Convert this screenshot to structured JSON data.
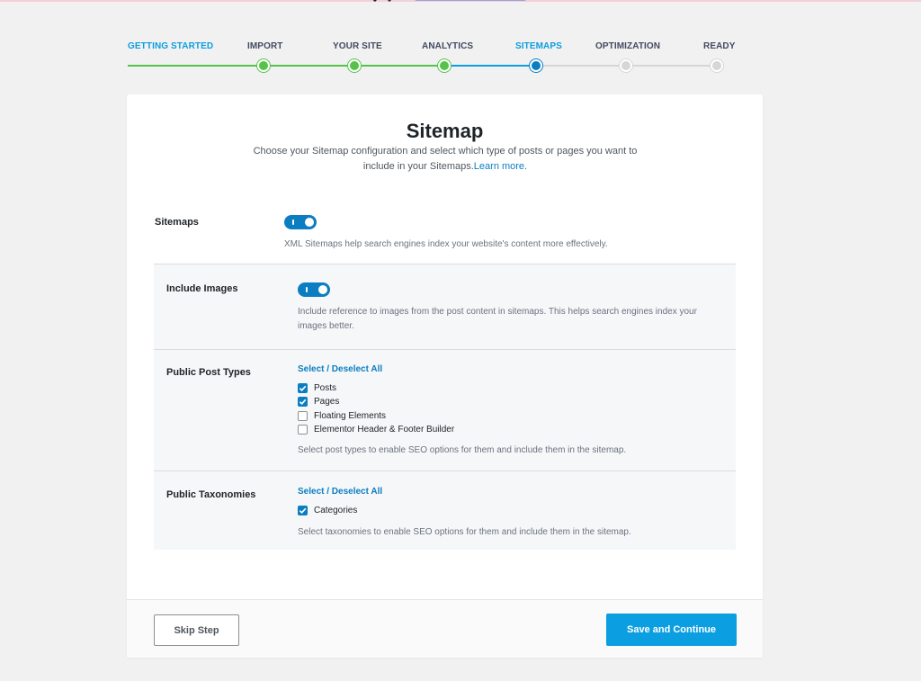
{
  "colors": {
    "accent": "#0b9ee0",
    "link": "#0b7ec2",
    "done_green": "#55c34a",
    "pending_gray": "#d6d6d6"
  },
  "steps": [
    {
      "label": "GETTING STARTED",
      "state": "done"
    },
    {
      "label": "IMPORT",
      "state": "done"
    },
    {
      "label": "YOUR SITE",
      "state": "done"
    },
    {
      "label": "ANALYTICS",
      "state": "done"
    },
    {
      "label": "SITEMAPS",
      "state": "active"
    },
    {
      "label": "OPTIMIZATION",
      "state": "pending"
    },
    {
      "label": "READY",
      "state": "pending"
    }
  ],
  "card": {
    "title": "Sitemap",
    "description": "Choose your Sitemap configuration and select which type of posts or pages you want to include in your Sitemaps.",
    "learn_more": "Learn more."
  },
  "sitemaps": {
    "label": "Sitemaps",
    "enabled": true,
    "help": "XML Sitemaps help search engines index your website's content more effectively."
  },
  "include_images": {
    "label": "Include Images",
    "enabled": true,
    "help": "Include reference to images from the post content in sitemaps. This helps search engines index your images better."
  },
  "post_types": {
    "label": "Public Post Types",
    "select_all": "Select / Deselect All",
    "items": [
      {
        "label": "Posts",
        "checked": true
      },
      {
        "label": "Pages",
        "checked": true
      },
      {
        "label": "Floating Elements",
        "checked": false
      },
      {
        "label": "Elementor Header & Footer Builder",
        "checked": false
      }
    ],
    "help": "Select post types to enable SEO options for them and include them in the sitemap."
  },
  "taxonomies": {
    "label": "Public Taxonomies",
    "select_all": "Select / Deselect All",
    "items": [
      {
        "label": "Categories",
        "checked": true
      }
    ],
    "help": "Select taxonomies to enable SEO options for them and include them in the sitemap."
  },
  "footer": {
    "skip_label": "Skip Step",
    "save_label": "Save and Continue"
  }
}
